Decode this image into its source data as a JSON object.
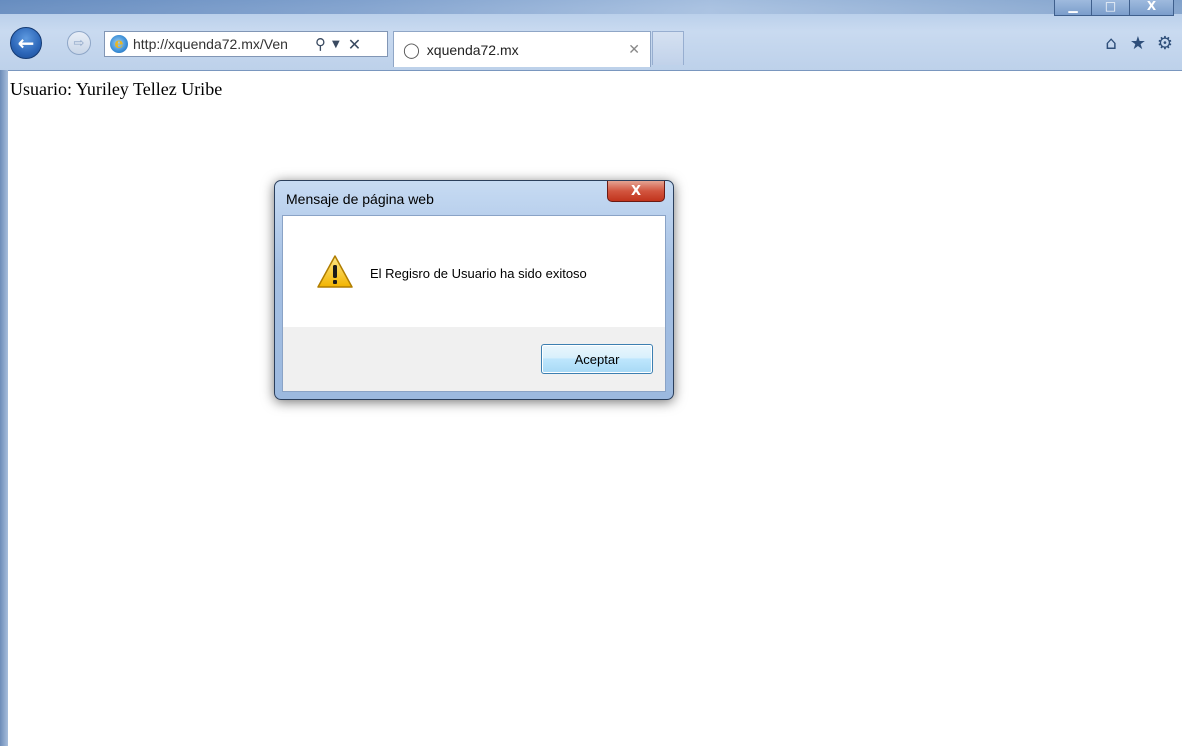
{
  "browser": {
    "url": "http://xquenda72.mx/Ven",
    "tab_title": "xquenda72.mx",
    "window_controls": {
      "minimize": "▁",
      "maximize": "□",
      "close": "X"
    },
    "icons": {
      "back": "back-arrow-icon",
      "forward": "forward-arrow-icon",
      "page": "ie-logo-icon",
      "search": "search-icon",
      "dropdown": "chevron-down-icon",
      "stop": "stop-icon",
      "loading": "loading-icon",
      "tab_close": "close-icon",
      "home": "home-icon",
      "favorites": "star-icon",
      "tools": "gear-icon"
    }
  },
  "page": {
    "user_label": "Usuario: Yuriley Tellez Uribe"
  },
  "dialog": {
    "title": "Mensaje de página web",
    "close_label": "X",
    "message": "El Regisro de Usuario ha sido exitoso",
    "ok_label": "Aceptar",
    "icon": "warning-icon"
  },
  "colors": {
    "chrome_blue": "#bdd1ea",
    "dialog_frame": "#a5c0e3",
    "close_red": "#c1341d",
    "button_blue": "#bee6fd"
  }
}
